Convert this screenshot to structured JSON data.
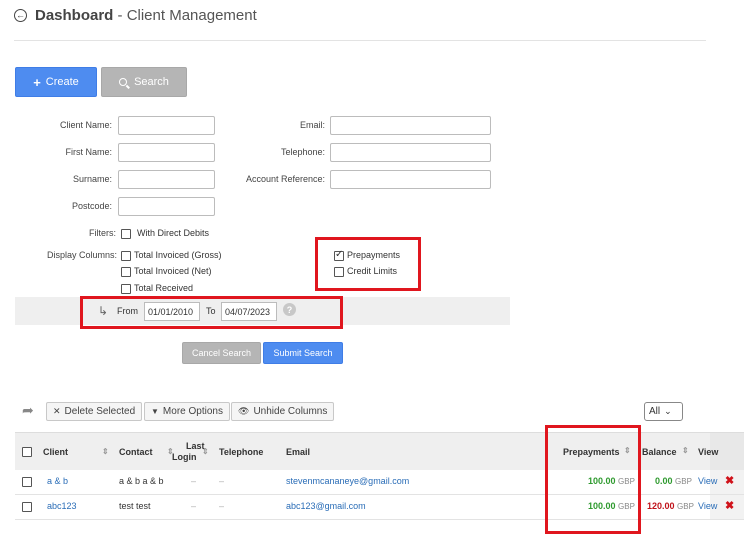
{
  "header": {
    "title_bold": "Dashboard",
    "title_rest": " - Client Management"
  },
  "toolbar": {
    "create_label": "Create",
    "search_label": "Search"
  },
  "form": {
    "client_name_label": "Client Name:",
    "first_name_label": "First Name:",
    "surname_label": "Surname:",
    "postcode_label": "Postcode:",
    "email_label": "Email:",
    "telephone_label": "Telephone:",
    "account_ref_label": "Account Reference:",
    "filters_label": "Filters:",
    "with_direct_debits": "With Direct Debits",
    "display_columns_label": "Display Columns:",
    "total_invoiced_gross": "Total Invoiced (Gross)",
    "total_invoiced_net": "Total Invoiced (Net)",
    "total_received": "Total Received",
    "prepayments": "Prepayments",
    "credit_limits": "Credit Limits"
  },
  "date_filter": {
    "from_label": "From",
    "from_value": "01/01/2010",
    "to_label": "To",
    "to_value": "04/07/2023"
  },
  "actions": {
    "cancel_label": "Cancel Search",
    "submit_label": "Submit Search"
  },
  "table_tools": {
    "delete_selected": "Delete Selected",
    "more_options": "More Options",
    "unhide_columns": "Unhide Columns",
    "page_size": "All"
  },
  "table": {
    "headers": {
      "client": "Client",
      "contact": "Contact",
      "last": "Last",
      "login": "Login",
      "telephone": "Telephone",
      "email": "Email",
      "prepayments": "Prepayments",
      "balance": "Balance",
      "view": "View"
    },
    "rows": [
      {
        "client": "a & b",
        "contact": "a & b a & b",
        "last_login": "–",
        "telephone": "–",
        "email": "stevenmcananeye@gmail.com",
        "prepayments": "100.00",
        "currency": "GBP",
        "balance": "0.00",
        "view": "View"
      },
      {
        "client": "abc123",
        "contact": "test test",
        "last_login": "–",
        "telephone": "–",
        "email": "abc123@gmail.com",
        "prepayments": "100.00",
        "currency": "GBP",
        "balance": "120.00",
        "view": "View"
      }
    ]
  }
}
